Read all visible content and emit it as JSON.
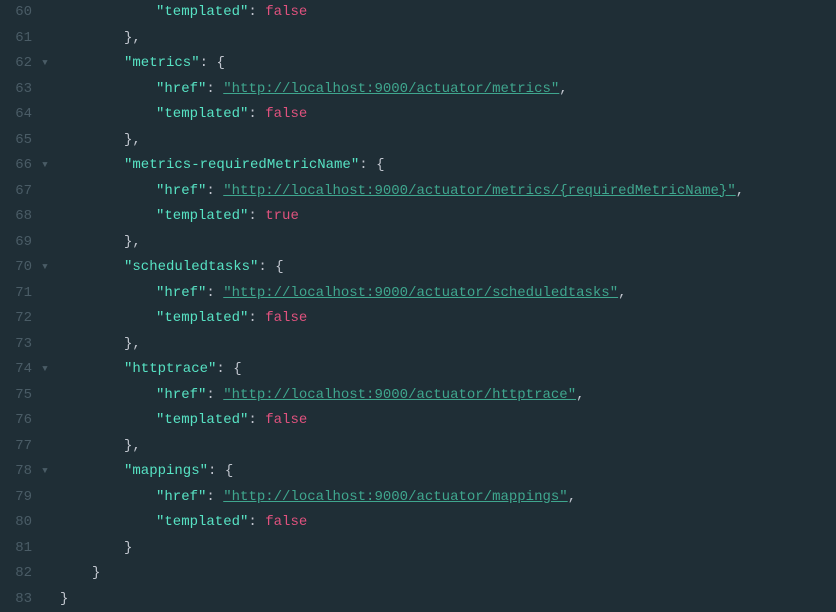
{
  "lines": [
    {
      "n": 60,
      "fold": "",
      "indent": 12,
      "tokens": [
        {
          "t": "key",
          "v": "\"templated\""
        },
        {
          "t": "colon",
          "v": ": "
        },
        {
          "t": "bool",
          "v": "false"
        }
      ]
    },
    {
      "n": 61,
      "fold": "",
      "indent": 8,
      "tokens": [
        {
          "t": "brace",
          "v": "},"
        }
      ]
    },
    {
      "n": 62,
      "fold": "▼",
      "indent": 8,
      "tokens": [
        {
          "t": "key",
          "v": "\"metrics\""
        },
        {
          "t": "colon",
          "v": ": "
        },
        {
          "t": "brace",
          "v": "{"
        }
      ]
    },
    {
      "n": 63,
      "fold": "",
      "indent": 12,
      "tokens": [
        {
          "t": "key",
          "v": "\"href\""
        },
        {
          "t": "colon",
          "v": ": "
        },
        {
          "t": "link",
          "v": "\"http://localhost:9000/actuator/metrics\""
        },
        {
          "t": "comma",
          "v": ","
        }
      ]
    },
    {
      "n": 64,
      "fold": "",
      "indent": 12,
      "tokens": [
        {
          "t": "key",
          "v": "\"templated\""
        },
        {
          "t": "colon",
          "v": ": "
        },
        {
          "t": "bool",
          "v": "false"
        }
      ]
    },
    {
      "n": 65,
      "fold": "",
      "indent": 8,
      "tokens": [
        {
          "t": "brace",
          "v": "},"
        }
      ]
    },
    {
      "n": 66,
      "fold": "▼",
      "indent": 8,
      "tokens": [
        {
          "t": "key",
          "v": "\"metrics-requiredMetricName\""
        },
        {
          "t": "colon",
          "v": ": "
        },
        {
          "t": "brace",
          "v": "{"
        }
      ]
    },
    {
      "n": 67,
      "fold": "",
      "indent": 12,
      "tokens": [
        {
          "t": "key",
          "v": "\"href\""
        },
        {
          "t": "colon",
          "v": ": "
        },
        {
          "t": "link",
          "v": "\"http://localhost:9000/actuator/metrics/{requiredMetricName}\""
        },
        {
          "t": "comma",
          "v": ","
        }
      ]
    },
    {
      "n": 68,
      "fold": "",
      "indent": 12,
      "tokens": [
        {
          "t": "key",
          "v": "\"templated\""
        },
        {
          "t": "colon",
          "v": ": "
        },
        {
          "t": "bool",
          "v": "true"
        }
      ]
    },
    {
      "n": 69,
      "fold": "",
      "indent": 8,
      "tokens": [
        {
          "t": "brace",
          "v": "},"
        }
      ]
    },
    {
      "n": 70,
      "fold": "▼",
      "indent": 8,
      "tokens": [
        {
          "t": "key",
          "v": "\"scheduledtasks\""
        },
        {
          "t": "colon",
          "v": ": "
        },
        {
          "t": "brace",
          "v": "{"
        }
      ]
    },
    {
      "n": 71,
      "fold": "",
      "indent": 12,
      "tokens": [
        {
          "t": "key",
          "v": "\"href\""
        },
        {
          "t": "colon",
          "v": ": "
        },
        {
          "t": "link",
          "v": "\"http://localhost:9000/actuator/scheduledtasks\""
        },
        {
          "t": "comma",
          "v": ","
        }
      ]
    },
    {
      "n": 72,
      "fold": "",
      "indent": 12,
      "tokens": [
        {
          "t": "key",
          "v": "\"templated\""
        },
        {
          "t": "colon",
          "v": ": "
        },
        {
          "t": "bool",
          "v": "false"
        }
      ]
    },
    {
      "n": 73,
      "fold": "",
      "indent": 8,
      "tokens": [
        {
          "t": "brace",
          "v": "},"
        }
      ]
    },
    {
      "n": 74,
      "fold": "▼",
      "indent": 8,
      "tokens": [
        {
          "t": "key",
          "v": "\"httptrace\""
        },
        {
          "t": "colon",
          "v": ": "
        },
        {
          "t": "brace",
          "v": "{"
        }
      ]
    },
    {
      "n": 75,
      "fold": "",
      "indent": 12,
      "tokens": [
        {
          "t": "key",
          "v": "\"href\""
        },
        {
          "t": "colon",
          "v": ": "
        },
        {
          "t": "link",
          "v": "\"http://localhost:9000/actuator/httptrace\""
        },
        {
          "t": "comma",
          "v": ","
        }
      ]
    },
    {
      "n": 76,
      "fold": "",
      "indent": 12,
      "tokens": [
        {
          "t": "key",
          "v": "\"templated\""
        },
        {
          "t": "colon",
          "v": ": "
        },
        {
          "t": "bool",
          "v": "false"
        }
      ]
    },
    {
      "n": 77,
      "fold": "",
      "indent": 8,
      "tokens": [
        {
          "t": "brace",
          "v": "},"
        }
      ]
    },
    {
      "n": 78,
      "fold": "▼",
      "indent": 8,
      "tokens": [
        {
          "t": "key",
          "v": "\"mappings\""
        },
        {
          "t": "colon",
          "v": ": "
        },
        {
          "t": "brace",
          "v": "{"
        }
      ]
    },
    {
      "n": 79,
      "fold": "",
      "indent": 12,
      "tokens": [
        {
          "t": "key",
          "v": "\"href\""
        },
        {
          "t": "colon",
          "v": ": "
        },
        {
          "t": "link",
          "v": "\"http://localhost:9000/actuator/mappings\""
        },
        {
          "t": "comma",
          "v": ","
        }
      ]
    },
    {
      "n": 80,
      "fold": "",
      "indent": 12,
      "tokens": [
        {
          "t": "key",
          "v": "\"templated\""
        },
        {
          "t": "colon",
          "v": ": "
        },
        {
          "t": "bool",
          "v": "false"
        }
      ]
    },
    {
      "n": 81,
      "fold": "",
      "indent": 8,
      "tokens": [
        {
          "t": "brace",
          "v": "}"
        }
      ]
    },
    {
      "n": 82,
      "fold": "",
      "indent": 4,
      "tokens": [
        {
          "t": "brace",
          "v": "}"
        }
      ]
    },
    {
      "n": 83,
      "fold": "",
      "indent": 0,
      "tokens": [
        {
          "t": "brace",
          "v": "}"
        }
      ]
    }
  ],
  "indentUnitPx": 8
}
